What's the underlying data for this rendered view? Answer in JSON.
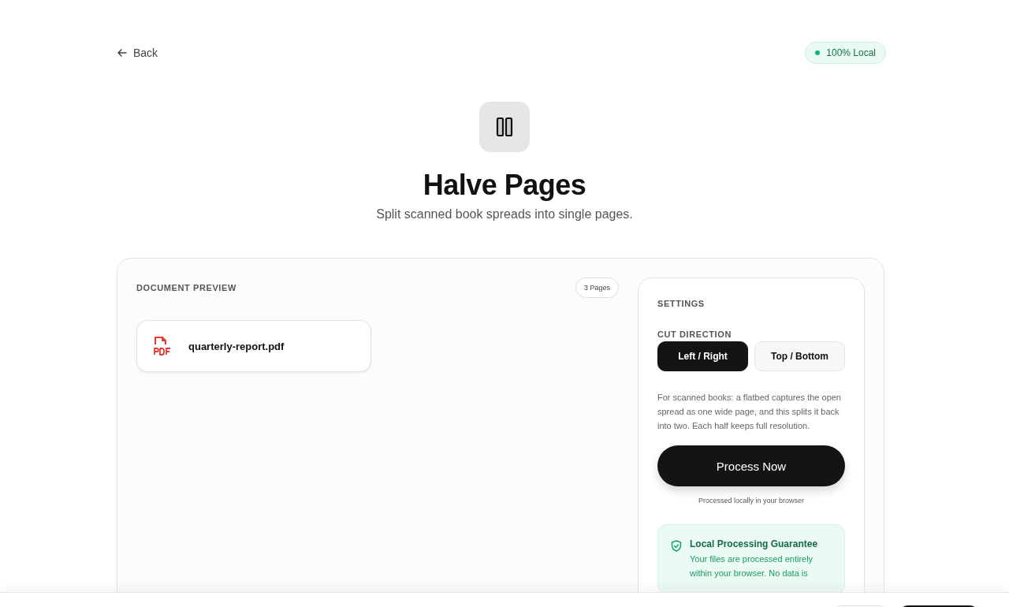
{
  "header": {
    "back_label": "Back",
    "badge": "100% Local"
  },
  "hero": {
    "title": "Halve Pages",
    "subtitle": "Split scanned book spreads into single pages."
  },
  "preview": {
    "heading": "DOCUMENT PREVIEW",
    "page_count": "3 Pages",
    "files": [
      {
        "name": "quarterly-report.pdf",
        "kind": "pdf"
      }
    ]
  },
  "settings": {
    "heading": "SETTINGS",
    "cut_label": "CUT DIRECTION",
    "options": [
      {
        "label": "Left / Right",
        "selected": true
      },
      {
        "label": "Top / Bottom",
        "selected": false
      }
    ],
    "description": "For scanned books: a flatbed captures the open spread as one wide page, and this splits it back into two. Each half keeps full resolution.",
    "process_button": "Process Now",
    "process_note": "Processed locally in your browser",
    "guarantee": {
      "title": "Local Processing Guarantee",
      "text": "Your files are processed entirely within your browser. No data is"
    }
  }
}
